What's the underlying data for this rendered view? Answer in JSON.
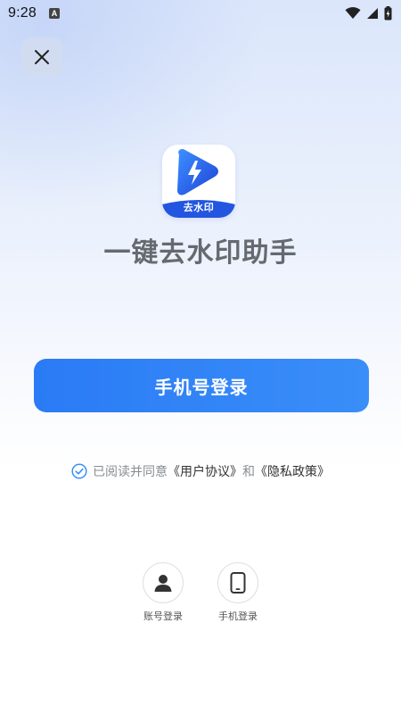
{
  "status_bar": {
    "time": "9:28",
    "notification_glyph": "A",
    "icons": [
      "wifi-icon",
      "signal-icon",
      "battery-icon"
    ]
  },
  "header": {
    "close_icon": "close-icon"
  },
  "app": {
    "icon_label": "去水印",
    "name": "一键去水印助手"
  },
  "actions": {
    "phone_login_label": "手机号登录"
  },
  "agreement": {
    "prefix": "已阅读并同意",
    "user_agreement": "《用户协议》",
    "conjunction": "和",
    "privacy_policy": "《隐私政策》",
    "checked": true
  },
  "alt_logins": [
    {
      "label": "账号登录",
      "icon": "user-icon"
    },
    {
      "label": "手机登录",
      "icon": "phone-icon"
    }
  ],
  "colors": {
    "accent": "#2a7bf5",
    "icon_gradient_start": "#3b8cff",
    "icon_gradient_end": "#2046d8",
    "check": "#3a8ef8"
  }
}
